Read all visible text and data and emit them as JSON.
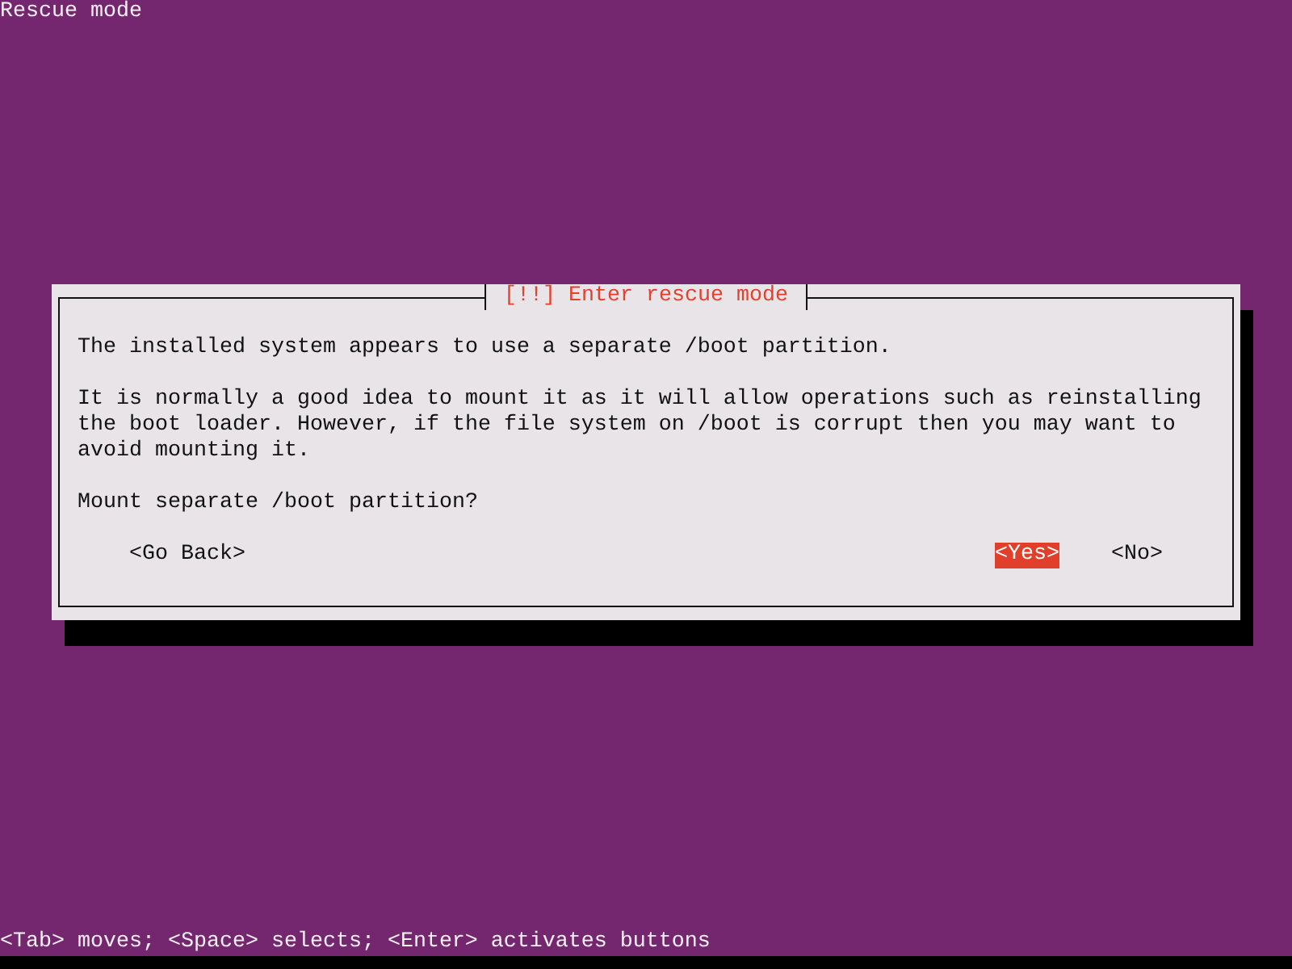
{
  "screen": {
    "title": "Rescue mode"
  },
  "dialog": {
    "title": "[!!] Enter rescue mode",
    "paragraphs": [
      "The installed system appears to use a separate /boot partition.",
      "It is normally a good idea to mount it as it will allow operations such as reinstalling the boot loader. However, if the file system on /boot is corrupt then you may want to avoid mounting it."
    ],
    "question": "Mount separate /boot partition?",
    "buttons": [
      {
        "label": "<Go Back>",
        "kind": "back",
        "selected": false
      },
      {
        "label": "<Yes>",
        "kind": "choice",
        "selected": true
      },
      {
        "label": "<No>",
        "kind": "choice",
        "selected": false
      }
    ]
  },
  "status_bar": {
    "text": "<Tab> moves; <Space> selects; <Enter> activates buttons"
  }
}
